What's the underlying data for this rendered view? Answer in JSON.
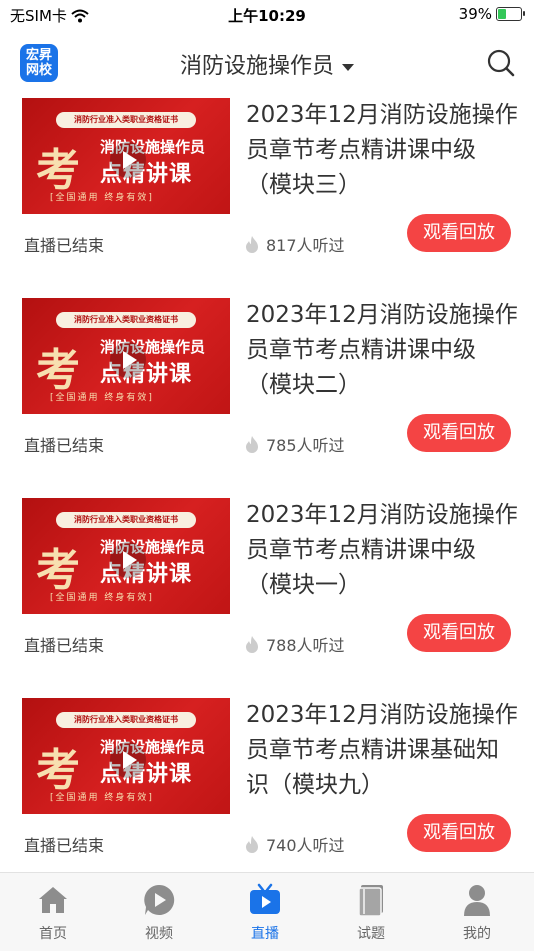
{
  "status_bar": {
    "carrier": "无SIM卡",
    "time": "上午10:29",
    "battery": "39%"
  },
  "header": {
    "logo_text": "宏昇网校",
    "title": "消防设施操作员",
    "icons": {
      "search": "search-icon",
      "dropdown": "caret-down-icon"
    }
  },
  "thumbnail": {
    "banner": "消防行业准入类职业资格证书",
    "big": "考",
    "line1": "消防设施操作员",
    "line2": "点精讲课",
    "foot": "[全国通用  终身有效]"
  },
  "courses": [
    {
      "title": "2023年12月消防设施操作员章节考点精讲课中级（模块三）",
      "status": "直播已结束",
      "views": "817人听过",
      "button": "观看回放"
    },
    {
      "title": "2023年12月消防设施操作员章节考点精讲课中级（模块二）",
      "status": "直播已结束",
      "views": "785人听过",
      "button": "观看回放"
    },
    {
      "title": "2023年12月消防设施操作员章节考点精讲课中级（模块一）",
      "status": "直播已结束",
      "views": "788人听过",
      "button": "观看回放"
    },
    {
      "title": "2023年12月消防设施操作员章节考点精讲课基础知识（模块九）",
      "status": "直播已结束",
      "views": "740人听过",
      "button": "观看回放"
    }
  ],
  "tabs": [
    {
      "label": "首页",
      "icon": "home-icon"
    },
    {
      "label": "视频",
      "icon": "video-icon"
    },
    {
      "label": "直播",
      "icon": "live-tv-icon"
    },
    {
      "label": "试题",
      "icon": "exam-book-icon"
    },
    {
      "label": "我的",
      "icon": "profile-icon"
    }
  ],
  "colors": {
    "accent": "#1a73e8",
    "replay_button": "#f44444",
    "thumbnail_red": "#c81818"
  }
}
